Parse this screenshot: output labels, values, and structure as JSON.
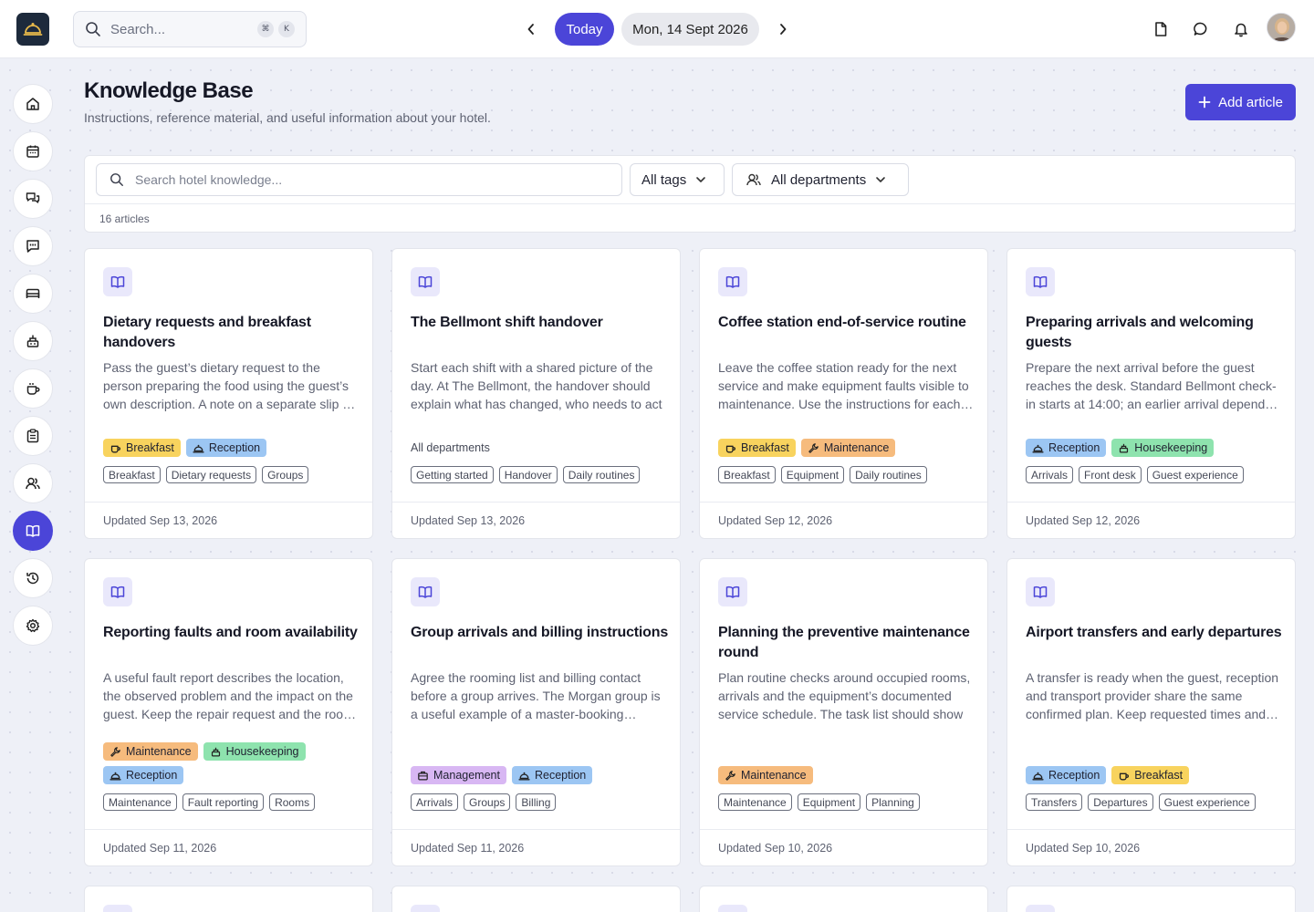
{
  "topbar": {
    "search_placeholder": "Search...",
    "shortcut_keys": [
      "⌘",
      "K"
    ],
    "today_label": "Today",
    "date_label": "Mon, 14 Sept 2026"
  },
  "page": {
    "title": "Knowledge Base",
    "subtitle": "Instructions, reference material, and useful information about your hotel.",
    "add_button": "Add article"
  },
  "filters": {
    "search_placeholder": "Search hotel knowledge...",
    "tags_label": "All tags",
    "departments_label": "All departments",
    "count_label": "16 articles"
  },
  "colors": {
    "accent": "#4b45d8",
    "Breakfast": "#f8d35e",
    "Reception": "#9cc6f3",
    "Maintenance": "#f6bb7d",
    "Housekeeping": "#8ee3ae",
    "Management": "#d8b7f3"
  },
  "articles": [
    {
      "title": "Dietary requests and breakfast handovers",
      "description": "Pass the guest’s dietary request to the person preparing the food using the guest’s own description. A note on a separate slip of paper should be",
      "departments": [
        "Breakfast",
        "Reception"
      ],
      "keywords": [
        "Breakfast",
        "Dietary requests",
        "Groups"
      ],
      "updated": "Updated Sep 13, 2026"
    },
    {
      "title": "The Bellmont shift handover",
      "description": "Start each shift with a shared picture of the day. At The Bellmont, the handover should explain what has changed, who needs to act",
      "departments": [],
      "departments_fallback": "All departments",
      "keywords": [
        "Getting started",
        "Handover",
        "Daily routines"
      ],
      "updated": "Updated Sep 13, 2026"
    },
    {
      "title": "Coffee station end-of-service routine",
      "description": "Leave the coffee station ready for the next service and make equipment faults visible to maintenance. Use the instructions for each machine",
      "departments": [
        "Breakfast",
        "Maintenance"
      ],
      "keywords": [
        "Breakfast",
        "Equipment",
        "Daily routines"
      ],
      "updated": "Updated Sep 12, 2026"
    },
    {
      "title": "Preparing arrivals and welcoming guests",
      "description": "Prepare the next arrival before the guest reaches the desk. Standard Bellmont check-in starts at 14:00; an earlier arrival depends on room status",
      "departments": [
        "Reception",
        "Housekeeping"
      ],
      "keywords": [
        "Arrivals",
        "Front desk",
        "Guest experience"
      ],
      "updated": "Updated Sep 12, 2026"
    },
    {
      "title": "Reporting faults and room availability",
      "description": "A useful fault report describes the location, the observed problem and the impact on the guest. Keep the repair request and the room status",
      "departments": [
        "Maintenance",
        "Housekeeping",
        "Reception"
      ],
      "keywords": [
        "Maintenance",
        "Fault reporting",
        "Rooms"
      ],
      "updated": "Updated Sep 11, 2026"
    },
    {
      "title": "Group arrivals and billing instructions",
      "description": "Agree the rooming list and billing contact before a group arrives. The Morgan group is a useful example of a master-booking arrangement",
      "departments": [
        "Management",
        "Reception"
      ],
      "keywords": [
        "Arrivals",
        "Groups",
        "Billing"
      ],
      "updated": "Updated Sep 11, 2026"
    },
    {
      "title": "Planning the preventive maintenance round",
      "description": "Plan routine checks around occupied rooms, arrivals and the equipment’s documented service schedule. The task list should show",
      "departments": [
        "Maintenance"
      ],
      "keywords": [
        "Maintenance",
        "Equipment",
        "Planning"
      ],
      "updated": "Updated Sep 10, 2026"
    },
    {
      "title": "Airport transfers and early departures",
      "description": "A transfer is ready when the guest, reception and transport provider share the same confirmed plan. Keep requested times and flight details",
      "departments": [
        "Reception",
        "Breakfast"
      ],
      "keywords": [
        "Transfers",
        "Departures",
        "Guest experience"
      ],
      "updated": "Updated Sep 10, 2026"
    }
  ]
}
